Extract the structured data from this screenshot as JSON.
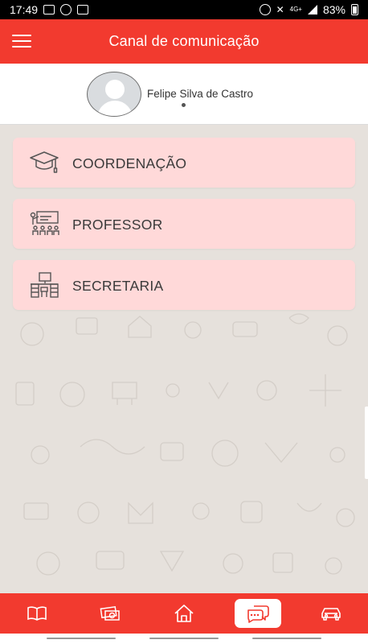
{
  "status_bar": {
    "time": "17:49",
    "network": "4G+",
    "battery": "83%",
    "icons": [
      "image-icon",
      "whatsapp-icon",
      "hd-icon",
      "alarm-icon",
      "mute-icon",
      "signal-icon",
      "battery-icon"
    ]
  },
  "app_bar": {
    "title": "Canal de comunicação",
    "menu_icon": "hamburger-menu-icon"
  },
  "profile": {
    "name": "Felipe Silva de Castro",
    "avatar_icon": "default-user-avatar"
  },
  "channels": [
    {
      "label": "COORDENAÇÃO",
      "icon": "graduation-cap-icon"
    },
    {
      "label": "PROFESSOR",
      "icon": "teacher-classroom-icon"
    },
    {
      "label": "SECRETARIA",
      "icon": "office-desk-icon"
    }
  ],
  "bottom_nav": [
    {
      "icon": "book-icon",
      "active": false
    },
    {
      "icon": "money-icon",
      "active": false
    },
    {
      "icon": "home-icon",
      "active": false
    },
    {
      "icon": "chat-icon",
      "active": true
    },
    {
      "icon": "car-icon",
      "active": false
    }
  ],
  "colors": {
    "primary": "#f23a2f",
    "card": "#ffd9d9",
    "background": "#e6e1dc"
  }
}
